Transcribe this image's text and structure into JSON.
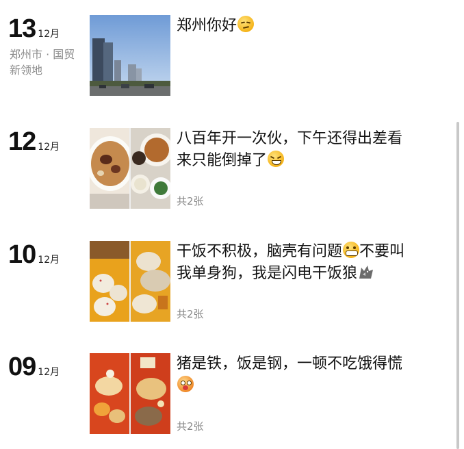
{
  "posts": [
    {
      "day": "13",
      "month": "12月",
      "location": "郑州市 · 国贸新领地",
      "text": "郑州你好",
      "emoji": "smirk-emoji",
      "count": ""
    },
    {
      "day": "12",
      "month": "12月",
      "location": "",
      "text": "八百年开一次伙，下午还得出差看来只能倒掉了",
      "emoji": "squint-laugh-emoji",
      "count": "共2张"
    },
    {
      "day": "10",
      "month": "12月",
      "location": "",
      "text": "干饭不积极，脑壳有问题",
      "text_after_emoji": "不要叫我单身狗，我是闪电干饭狼",
      "emoji": "grimace-emoji",
      "emoji_end": "wolf-icon",
      "count": "共2张"
    },
    {
      "day": "09",
      "month": "12月",
      "location": "",
      "text": "猪是铁，饭是钢，一顿不吃饿得慌",
      "emoji": "shocked-tongue-emoji",
      "count": "共2张"
    }
  ],
  "colors": {
    "text": "#111111",
    "muted": "#8a8a8a",
    "emoji": "#f5b41a"
  }
}
